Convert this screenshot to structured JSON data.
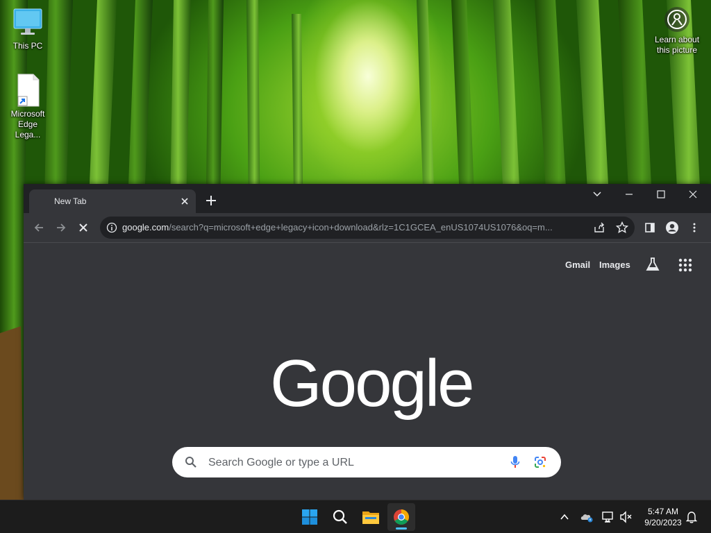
{
  "desktop": {
    "icons": [
      {
        "label": "This PC",
        "icon": "monitor-icon"
      },
      {
        "label": "Microsoft Edge Lega...",
        "icon": "document-shortcut-icon"
      }
    ],
    "learn_about": "Learn about this picture"
  },
  "browser": {
    "tab_title": "New Tab",
    "url_host": "google.com",
    "url_path": "/search?q=microsoft+edge+legacy+icon+download&rlz=1C1GCEA_enUS1074US1076&oq=m...",
    "page": {
      "links": {
        "gmail": "Gmail",
        "images": "Images"
      },
      "logo": "Google",
      "search_placeholder": "Search Google or type a URL"
    }
  },
  "taskbar": {
    "apps": [
      "start",
      "search",
      "file-explorer",
      "chrome"
    ],
    "time": "5:47 AM",
    "date": "9/20/2023"
  },
  "colors": {
    "browser_bg": "#35363a",
    "titlebar": "#202124",
    "taskbar": "#1c1c1c",
    "accent": "#4cc2ff"
  }
}
